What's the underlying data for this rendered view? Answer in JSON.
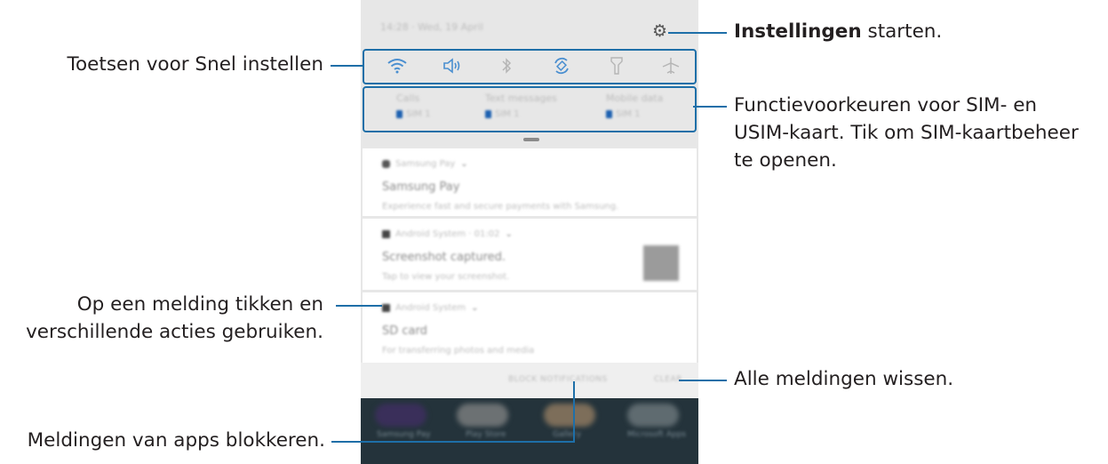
{
  "callouts": {
    "settings_bold": "Instellingen",
    "settings_rest": " starten.",
    "quick_settings": "Toetsen voor Snel instellen",
    "sim_line1": "Functievoorkeuren voor SIM- en",
    "sim_line2": "USIM-kaart. Tik om SIM-kaartbeheer",
    "sim_line3": "te openen.",
    "notification_line1": "Op een melding tikken en",
    "notification_line2": "verschillende acties gebruiken.",
    "clear_all": "Alle meldingen wissen.",
    "block_apps": "Meldingen van apps blokkeren."
  },
  "phone": {
    "status_time": "14:28",
    "status_date": "Wed, 19 April",
    "quick_settings": [
      {
        "icon": "wifi-icon",
        "glyph": "ᯤ",
        "active": true
      },
      {
        "icon": "sound-icon",
        "glyph": "🔈",
        "active": true
      },
      {
        "icon": "bluetooth-icon",
        "glyph": "✱",
        "active": false
      },
      {
        "icon": "rotate-icon",
        "glyph": "⟳",
        "active": true
      },
      {
        "icon": "flashlight-icon",
        "glyph": "♙",
        "active": false
      },
      {
        "icon": "airplane-icon",
        "glyph": "✈",
        "active": false
      }
    ],
    "sim": [
      {
        "title": "Calls",
        "value": "SIM 1"
      },
      {
        "title": "Text messages",
        "value": "SIM 1"
      },
      {
        "title": "Mobile data",
        "value": "SIM 1"
      }
    ],
    "notifications": [
      {
        "app": "Samsung Pay",
        "title": "Samsung Pay",
        "text": "Experience fast and secure payments with Samsung."
      },
      {
        "app": "Android System · 01:02",
        "title": "Screenshot captured.",
        "text": "Tap to view your screenshot."
      },
      {
        "app": "Android System",
        "title": "SD card",
        "text": "For transferring photos and media"
      }
    ],
    "actions": {
      "block": "BLOCK NOTIFICATIONS",
      "clear": "CLEAR"
    },
    "dock": [
      "Samsung Pay",
      "Play Store",
      "Gallery",
      "Microsoft Apps"
    ]
  }
}
